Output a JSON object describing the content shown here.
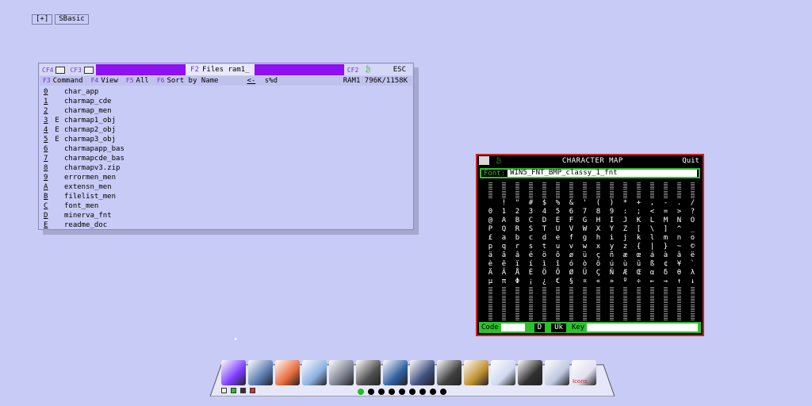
{
  "top_tabs": [
    {
      "label": "[+]"
    },
    {
      "label": "SBasic"
    }
  ],
  "files_window": {
    "toolbar_left": [
      "CF4",
      "CF3"
    ],
    "title_key": "F2",
    "title": "Files ram1_",
    "right_key": "CF2",
    "esc": "ESC",
    "menu": [
      {
        "key": "F3",
        "label": "Command"
      },
      {
        "key": "F4",
        "label": "View"
      },
      {
        "key": "F5",
        "label": "All"
      },
      {
        "key": "F6",
        "label": "Sort by Name"
      }
    ],
    "nav_left": "<-",
    "nav_right": "s%d",
    "ram_status": "RAM1 796K/1158K",
    "files": [
      {
        "key": "0",
        "flag": "",
        "name": "char_app"
      },
      {
        "key": "1",
        "flag": "",
        "name": "charmap_cde"
      },
      {
        "key": "2",
        "flag": "",
        "name": "charmap_men"
      },
      {
        "key": "3",
        "flag": "E",
        "name": "charmap1_obj"
      },
      {
        "key": "4",
        "flag": "E",
        "name": "charmap2_obj"
      },
      {
        "key": "5",
        "flag": "E",
        "name": "charmap3_obj"
      },
      {
        "key": "6",
        "flag": "",
        "name": "charmapapp_bas"
      },
      {
        "key": "7",
        "flag": "",
        "name": "charmapcde_bas"
      },
      {
        "key": "8",
        "flag": "",
        "name": "charmapv3.zip"
      },
      {
        "key": "9",
        "flag": "",
        "name": "errormen_men"
      },
      {
        "key": "A",
        "flag": "",
        "name": "extensn_men"
      },
      {
        "key": "B",
        "flag": "",
        "name": "filelist_men"
      },
      {
        "key": "C",
        "flag": "",
        "name": "font_men"
      },
      {
        "key": "D",
        "flag": "",
        "name": "minerva_fnt"
      },
      {
        "key": "E",
        "flag": "",
        "name": "readme_doc"
      }
    ]
  },
  "charmap_window": {
    "title": "CHARACTER MAP",
    "quit": "Quit",
    "font_label": "Font:",
    "font_value": "WIN5_FNT_BMP_classy_1_fnt",
    "rows": [
      "░░░░░░░░░░░░░░░░",
      "░░░░░░░░░░░░░░░░",
      " !\"#$%&'()*+,-./",
      "0123456789:;<=>?",
      "@ABCDEFGHIJKLMNO",
      "PQRSTUVWXYZ[\\]^_",
      "£abcdefghijklmno",
      "pqrstuvwxyz{|}~©",
      "äãâéöõøüçñæœáàâë",
      "èêïíìîóòôúùûß¢¥`",
      "ÄÃÅÉÖÕØÜÇÑÆŒαδθλ",
      "μπΦ¡¿€§¤«»º÷←→↑↓",
      "░░░░░░░░░░░░░░░░",
      "░░░░░░░░░░░░░░░░",
      "░░░░░░░░░░░░░░░░",
      "░░░░░░░░░░░░░░░░"
    ],
    "code_label": "Code",
    "d_button": "D",
    "uk_button": "Uk",
    "key_label": "Key"
  },
  "dock": {
    "icons": [
      {
        "name": "color-palette-icon",
        "color": "#7a3cff"
      },
      {
        "name": "screen-capture-icon",
        "color": "#5a7ab0"
      },
      {
        "name": "photos-icon",
        "color": "#e86a3a"
      },
      {
        "name": "image-viewer-icon",
        "color": "#8ab0e0"
      },
      {
        "name": "tools-icon",
        "color": "#7a8090"
      },
      {
        "name": "settings-gear-icon",
        "color": "#505050"
      },
      {
        "name": "file-cabinet-icon",
        "color": "#3060a0"
      },
      {
        "name": "computer-icon",
        "color": "#405080"
      },
      {
        "name": "calculator-icon",
        "color": "#404040"
      },
      {
        "name": "archive-icon",
        "color": "#c09030"
      },
      {
        "name": "contact-card-icon",
        "color": "#d0d8f0"
      },
      {
        "name": "spy-agent-icon",
        "color": "#303030"
      },
      {
        "name": "document-icon",
        "color": "#c0c8e0"
      },
      {
        "name": "icon-editor-icon",
        "color": "#e0e0f0"
      }
    ],
    "icon_editor_label": "Icons",
    "pages": 9,
    "active_page": 0
  },
  "colors": {
    "desktop": "#c8cbf6",
    "files_title_bar": "#8f10f0",
    "charmap_accent": "#2ec02e",
    "charmap_border": "#cc2020"
  }
}
